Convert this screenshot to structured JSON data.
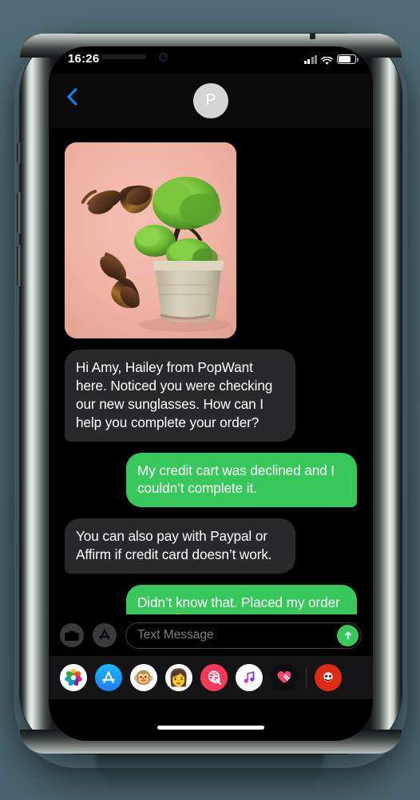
{
  "status_bar": {
    "time": "16:26",
    "signal_icon": "cellular-signal-icon",
    "signal_bars_filled": 2,
    "signal_bars_total": 4,
    "wifi_icon": "wifi-icon",
    "battery_icon": "battery-icon",
    "battery_level_percent": 68
  },
  "nav": {
    "back_icon": "chevron-left-icon",
    "avatar_initial": "P"
  },
  "conversation": {
    "attachment": {
      "type": "image",
      "alt": "Tortoiseshell sunglasses with potted bonsai plant on pink background",
      "background_color": "#eeb3a3"
    },
    "messages": [
      {
        "sender": "them",
        "text": "Hi Amy, Hailey from PopWant here. Noticed you were checking our new sunglasses. How can I help you complete your order?"
      },
      {
        "sender": "me",
        "text": "My credit cart was declined and I couldn’t complete it."
      },
      {
        "sender": "them",
        "text": "You can also pay with Paypal or Affirm if credit card doesn’t work."
      },
      {
        "sender": "me",
        "text": "Didn’t know that. Placed my order now! 😍"
      }
    ]
  },
  "input_bar": {
    "camera_icon": "camera-icon",
    "appstore_icon": "app-store-icon",
    "placeholder": "Text Message",
    "value": "",
    "send_icon": "send-arrow-up-icon"
  },
  "app_drawer": {
    "apps": [
      {
        "name": "photos-app-icon",
        "glyph": "✿"
      },
      {
        "name": "app-store-app-icon",
        "glyph": "A"
      },
      {
        "name": "animoji-monkey-icon",
        "glyph": "🐵"
      },
      {
        "name": "memoji-person-icon",
        "glyph": "👩"
      },
      {
        "name": "images-search-icon",
        "glyph": "🔍"
      },
      {
        "name": "apple-music-icon",
        "glyph": "♫"
      },
      {
        "name": "digital-touch-heart-icon",
        "glyph": "💗"
      },
      {
        "name": "more-apps-icon",
        "glyph": "◉"
      }
    ]
  },
  "home_indicator": "home-indicator",
  "colors": {
    "bubble_incoming": "#29292b",
    "bubble_outgoing": "#37c75b",
    "accent_blue": "#0a84ff",
    "screen_background": "#000000",
    "page_background": "#4e6a73"
  }
}
